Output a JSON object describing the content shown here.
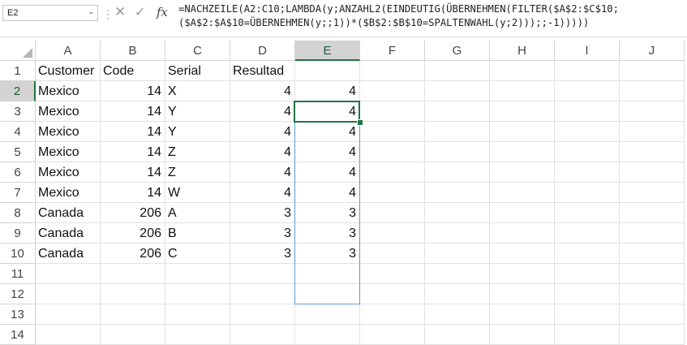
{
  "namebox": {
    "cell": "E2"
  },
  "formula_bar": {
    "fx_label": "fx",
    "line1": "=NACHZEILE(A2:C10;LAMBDA(y;ANZAHL2(EINDEUTIG(ÜBERNEHMEN(FILTER($A$2:$C$10;",
    "line2": "($A$2:$A$10=ÜBERNEHMEN(y;;1))*($B$2:$B$10=SPALTENWAHL(y;2)));;-1)))))"
  },
  "columns": [
    "A",
    "B",
    "C",
    "D",
    "E",
    "F",
    "G",
    "H",
    "I",
    "J"
  ],
  "selected_column": "E",
  "selected_row": "2",
  "rows": [
    "1",
    "2",
    "3",
    "4",
    "5",
    "6",
    "7",
    "8",
    "9",
    "10",
    "11",
    "12",
    "13",
    "14"
  ],
  "headers": {
    "A": "Customer",
    "B": "Code",
    "C": "Serial",
    "D": "Resultad"
  },
  "data": [
    {
      "A": "Mexico",
      "B": "14",
      "C": "X",
      "D": "4",
      "E": "4"
    },
    {
      "A": "Mexico",
      "B": "14",
      "C": "Y",
      "D": "4",
      "E": "4"
    },
    {
      "A": "Mexico",
      "B": "14",
      "C": "Y",
      "D": "4",
      "E": "4"
    },
    {
      "A": "Mexico",
      "B": "14",
      "C": "Z",
      "D": "4",
      "E": "4"
    },
    {
      "A": "Mexico",
      "B": "14",
      "C": "Z",
      "D": "4",
      "E": "4"
    },
    {
      "A": "Mexico",
      "B": "14",
      "C": "W",
      "D": "4",
      "E": "4"
    },
    {
      "A": "Canada",
      "B": "206",
      "C": "A",
      "D": "3",
      "E": "3"
    },
    {
      "A": "Canada",
      "B": "206",
      "C": "B",
      "D": "3",
      "E": "3"
    },
    {
      "A": "Canada",
      "B": "206",
      "C": "C",
      "D": "3",
      "E": "3"
    }
  ],
  "colors": {
    "accent": "#217346",
    "spill_border": "#5b9bd5",
    "header_selected": "#d3d3d3"
  }
}
